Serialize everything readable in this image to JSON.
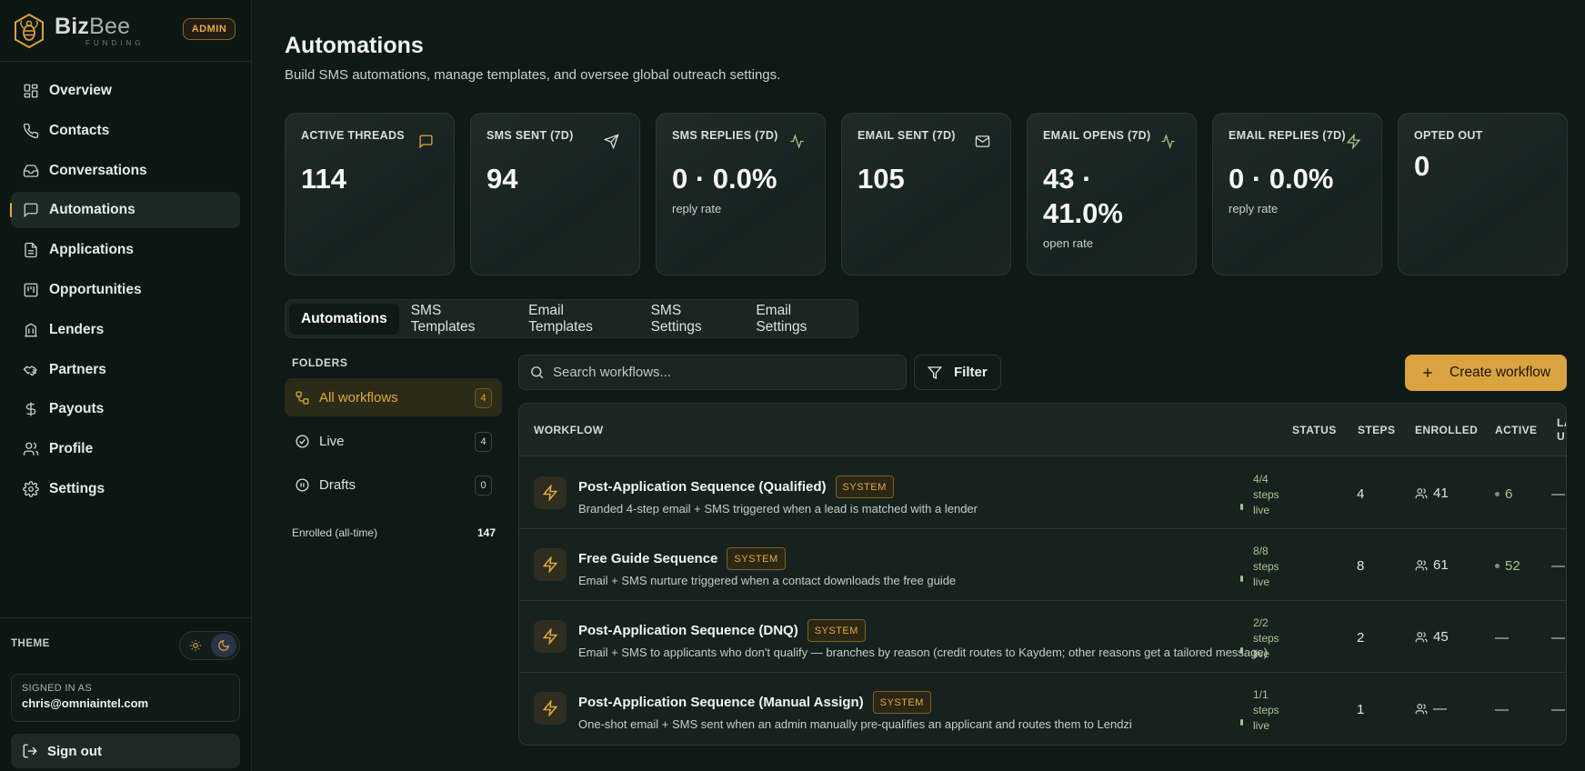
{
  "brand": {
    "name_bold": "Biz",
    "name_light": "Bee",
    "sub": "FUNDING",
    "role_badge": "ADMIN"
  },
  "nav": [
    {
      "label": "Overview",
      "icon": "grid-icon"
    },
    {
      "label": "Contacts",
      "icon": "phone-icon"
    },
    {
      "label": "Conversations",
      "icon": "inbox-icon"
    },
    {
      "label": "Automations",
      "icon": "message-square-icon",
      "active": true
    },
    {
      "label": "Applications",
      "icon": "file-text-icon"
    },
    {
      "label": "Opportunities",
      "icon": "kanban-icon"
    },
    {
      "label": "Lenders",
      "icon": "building-icon"
    },
    {
      "label": "Partners",
      "icon": "handshake-icon"
    },
    {
      "label": "Payouts",
      "icon": "dollar-icon"
    },
    {
      "label": "Profile",
      "icon": "users-icon"
    },
    {
      "label": "Settings",
      "icon": "gear-icon"
    }
  ],
  "theme": {
    "label": "THEME"
  },
  "account": {
    "signed_in_label": "SIGNED IN AS",
    "email": "chris@omniaintel.com",
    "sign_out": "Sign out"
  },
  "page": {
    "title": "Automations",
    "subtitle": "Build SMS automations, manage templates, and oversee global outreach settings."
  },
  "stats": [
    {
      "label": "ACTIVE THREADS",
      "value": "114",
      "sub": "",
      "icon": "message-square-icon",
      "icon_color": "#e3a93d"
    },
    {
      "label": "SMS SENT (7D)",
      "value": "94",
      "sub": "",
      "icon": "send-icon",
      "icon_color": "#d9dfdc"
    },
    {
      "label": "SMS REPLIES (7D)",
      "value": "0 · 0.0%",
      "sub": "reply rate",
      "icon": "activity-icon",
      "icon_color": "#a8c58f"
    },
    {
      "label": "EMAIL SENT (7D)",
      "value": "105",
      "sub": "",
      "icon": "mail-icon",
      "icon_color": "#d9dfdc"
    },
    {
      "label": "EMAIL OPENS (7D)",
      "value_line1": "43 ·",
      "value_line2": "41.0%",
      "sub": "open rate",
      "icon": "activity-icon",
      "icon_color": "#a8c58f"
    },
    {
      "label": "EMAIL REPLIES (7D)",
      "value": "0 · 0.0%",
      "sub": "reply rate",
      "icon": "zap-icon",
      "icon_color": "#a8c58f"
    },
    {
      "label": "OPTED OUT",
      "value": "0",
      "sub": "",
      "icon": "",
      "icon_color": ""
    }
  ],
  "tabs": [
    "Automations",
    "SMS Templates",
    "Email Templates",
    "SMS Settings",
    "Email Settings"
  ],
  "folders": {
    "title": "FOLDERS",
    "items": [
      {
        "label": "All workflows",
        "count": "4",
        "icon": "workflow-icon",
        "active": true
      },
      {
        "label": "Live",
        "count": "4",
        "icon": "check-circle-icon"
      },
      {
        "label": "Drafts",
        "count": "0",
        "icon": "pause-circle-icon"
      }
    ],
    "enrolled_label": "Enrolled (all-time)",
    "enrolled_value": "147"
  },
  "toolbar": {
    "search_placeholder": "Search workflows...",
    "filter_label": "Filter",
    "create_label": "Create workflow"
  },
  "table": {
    "headers": {
      "workflow": "WORKFLOW",
      "status": "STATUS",
      "steps": "STEPS",
      "enrolled": "ENROLLED",
      "active": "ACTIVE",
      "last_l1": "LA",
      "last_l2": "U"
    },
    "rows": [
      {
        "name": "Post-Application Sequence (Qualified)",
        "badge": "SYSTEM",
        "desc": "Branded 4-step email + SMS triggered when a lead is matched with a lender",
        "status_l1": "4/4",
        "status_l2": "steps",
        "status_l3": "live",
        "steps": "4",
        "enrolled": "41",
        "active": "6",
        "last": "—"
      },
      {
        "name": "Free Guide Sequence",
        "badge": "SYSTEM",
        "desc": "Email + SMS nurture triggered when a contact downloads the free guide",
        "status_l1": "8/8",
        "status_l2": "steps",
        "status_l3": "live",
        "steps": "8",
        "enrolled": "61",
        "active": "52",
        "last": "—"
      },
      {
        "name": "Post-Application Sequence (DNQ)",
        "badge": "SYSTEM",
        "desc": "Email + SMS to applicants who don't qualify — branches by reason (credit routes to Kaydem; other reasons get a tailored message)",
        "status_l1": "2/2",
        "status_l2": "steps",
        "status_l3": "live",
        "steps": "2",
        "enrolled": "45",
        "active": "—",
        "last": "—"
      },
      {
        "name": "Post-Application Sequence (Manual Assign)",
        "badge": "SYSTEM",
        "desc": "One-shot email + SMS sent when an admin manually pre-qualifies an applicant and routes them to Lendzi",
        "status_l1": "1/1",
        "status_l2": "steps",
        "status_l3": "live",
        "steps": "1",
        "enrolled": "—",
        "active": "—",
        "last": "—"
      }
    ]
  }
}
